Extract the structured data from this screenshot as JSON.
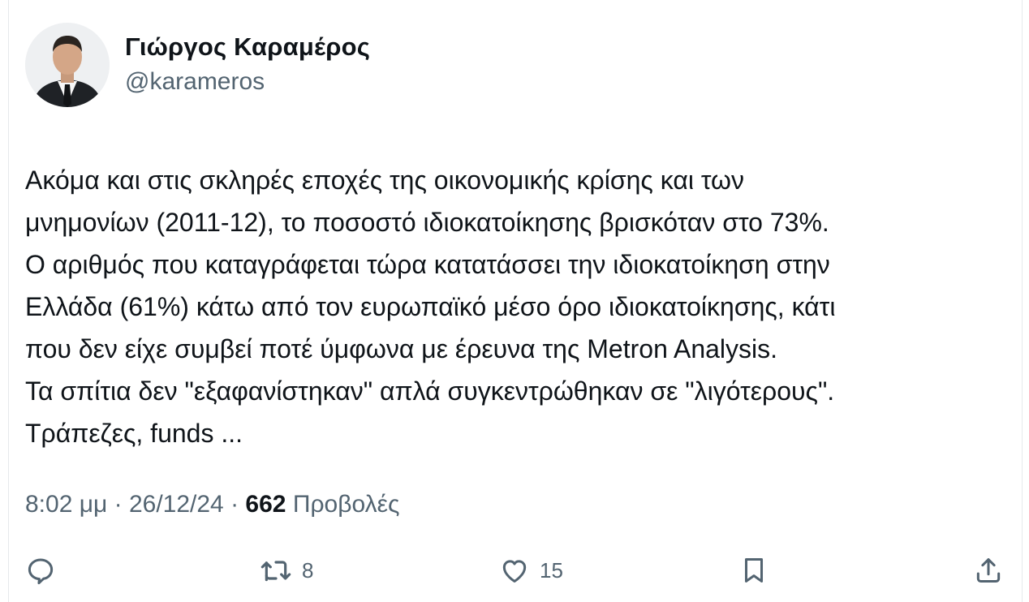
{
  "author": {
    "display_name": "Γιώργος Καραμέρος",
    "handle": "@karameros"
  },
  "tweet": {
    "lines": [
      "Ακόμα και στις σκληρές εποχές της οικονομικής κρίσης και των",
      "μνημονίων (2011-12), το ποσοστό ιδιοκατοίκησης βρισκόταν στο 73%.",
      "Ο αριθμός που καταγράφεται τώρα κατατάσσει την ιδιοκατοίκηση στην",
      "Ελλάδα (61%)  κάτω από τον ευρωπαϊκό μέσο όρο ιδιοκατοίκησης, κάτι",
      "που δεν είχε συμβεί ποτέ ύμφωνα με έρευνα της Metron Analysis.",
      "Τα σπίτια δεν \"εξαφανίστηκαν\" απλά συγκεντρώθηκαν σε \"λιγότερους\".",
      "Τράπεζες, funds ..."
    ]
  },
  "meta": {
    "time": "8:02 μμ",
    "separator": " · ",
    "date": "26/12/24",
    "views_count": "662",
    "views_label": "Προβολές"
  },
  "actions": {
    "reply_icon": "reply-icon",
    "retweet_icon": "retweet-icon",
    "retweet_count": "8",
    "like_icon": "heart-icon",
    "like_count": "15",
    "bookmark_icon": "bookmark-icon",
    "share_icon": "share-icon"
  },
  "colors": {
    "text": "#0f1419",
    "secondary": "#536471",
    "border": "#e6e9ec"
  }
}
